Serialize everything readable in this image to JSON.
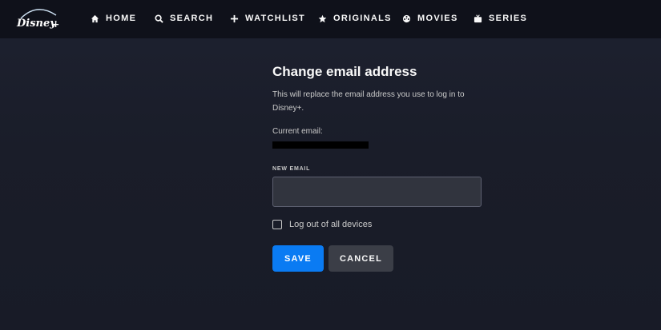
{
  "nav": {
    "logo_name": "Disney+",
    "items": [
      {
        "label": "HOME",
        "icon": "home-icon"
      },
      {
        "label": "SEARCH",
        "icon": "search-icon"
      },
      {
        "label": "WATCHLIST",
        "icon": "plus-icon"
      },
      {
        "label": "ORIGINALS",
        "icon": "star-icon"
      },
      {
        "label": "MOVIES",
        "icon": "film-reel-icon"
      },
      {
        "label": "SERIES",
        "icon": "tv-icon"
      }
    ]
  },
  "form": {
    "title": "Change email address",
    "description": "This will replace the email address you use to log in to Disney+.",
    "current_email_label": "Current email:",
    "current_email_value": "",
    "new_email_label": "NEW EMAIL",
    "new_email_value": "",
    "new_email_placeholder": "",
    "logout_label": "Log out of all devices",
    "save_label": "SAVE",
    "cancel_label": "CANCEL"
  },
  "colors": {
    "background": "#1a1d29",
    "navbar": "#0f111a",
    "save_button": "#0a7bf3",
    "cancel_button": "#3b3e47",
    "input_background": "#31343e"
  }
}
